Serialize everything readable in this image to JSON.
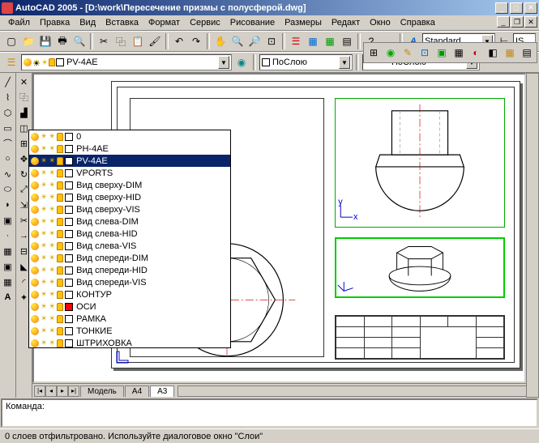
{
  "title": "AutoCAD 2005 - [D:\\work\\Пересечение призмы с полусферой.dwg]",
  "menu": [
    "Файл",
    "Правка",
    "Вид",
    "Вставка",
    "Формат",
    "Сервис",
    "Рисование",
    "Размеры",
    "Редакт",
    "Окно",
    "Справка"
  ],
  "style_combo": "Standard",
  "style_combo2": "IS",
  "layer_combo_selected": "PV-4AE",
  "color_combo": "ПоСлою",
  "linetype_combo": "ПоСлою",
  "layers": [
    {
      "name": "0",
      "color": "#fff"
    },
    {
      "name": "PH-4AE",
      "color": "#fff"
    },
    {
      "name": "PV-4AE",
      "color": "#fff",
      "selected": true
    },
    {
      "name": "VPORTS",
      "color": "#fff"
    },
    {
      "name": "Вид сверху-DIM",
      "color": "#fff"
    },
    {
      "name": "Вид сверху-HID",
      "color": "#fff"
    },
    {
      "name": "Вид сверху-VIS",
      "color": "#fff"
    },
    {
      "name": "Вид слева-DIM",
      "color": "#fff"
    },
    {
      "name": "Вид слева-HID",
      "color": "#fff"
    },
    {
      "name": "Вид слева-VIS",
      "color": "#fff"
    },
    {
      "name": "Вид спереди-DIM",
      "color": "#fff"
    },
    {
      "name": "Вид спереди-HID",
      "color": "#fff"
    },
    {
      "name": "Вид спереди-VIS",
      "color": "#fff"
    },
    {
      "name": "КОНТУР",
      "color": "#fff"
    },
    {
      "name": "ОСИ",
      "color": "#f00"
    },
    {
      "name": "РАМКА",
      "color": "#fff"
    },
    {
      "name": "ТОНКИЕ",
      "color": "#fff"
    },
    {
      "name": "ШТРИХОВКА",
      "color": "#fff"
    }
  ],
  "tabs": [
    "Модель",
    "A4",
    "A3"
  ],
  "active_tab": "A3",
  "command_prompt": "Команда:",
  "status_text": "0 слоев отфильтровано.  Используйте диалоговое окно \"Слои\"",
  "icons": {
    "new": "▢",
    "open": "📁",
    "save": "💾",
    "print": "🖶",
    "preview": "🔍",
    "cut": "✂",
    "copy": "⿻",
    "paste": "📋",
    "match": "🖌",
    "undo": "↶",
    "redo": "↷",
    "pan": "✋",
    "zoom": "🔍",
    "zoomw": "🔎",
    "zoomall": "⊡",
    "props": "☰",
    "dwf": "▤",
    "help": "?",
    "style": "A",
    "dim": "⊢",
    "line": "╱",
    "pline": "⌇",
    "polygon": "⬡",
    "rect": "▭",
    "arc": "⌒",
    "circle": "○",
    "spline": "∿",
    "ellipse": "⬭",
    "ellipsearc": "◗",
    "point": "·",
    "hatch": "▦",
    "region": "▣",
    "text": "A",
    "mtext": "T",
    "block": "▣",
    "table": "▦",
    "erase": "✕",
    "copyobj": "⿻",
    "mirror": "▟",
    "offset": "◫",
    "array": "⊞",
    "move": "✥",
    "rotate": "↻",
    "scale": "⤢",
    "stretch": "⇲",
    "trim": "✂",
    "extend": "→",
    "break": "⊟",
    "chamfer": "◣",
    "fillet": "◜",
    "explode": "✦"
  }
}
